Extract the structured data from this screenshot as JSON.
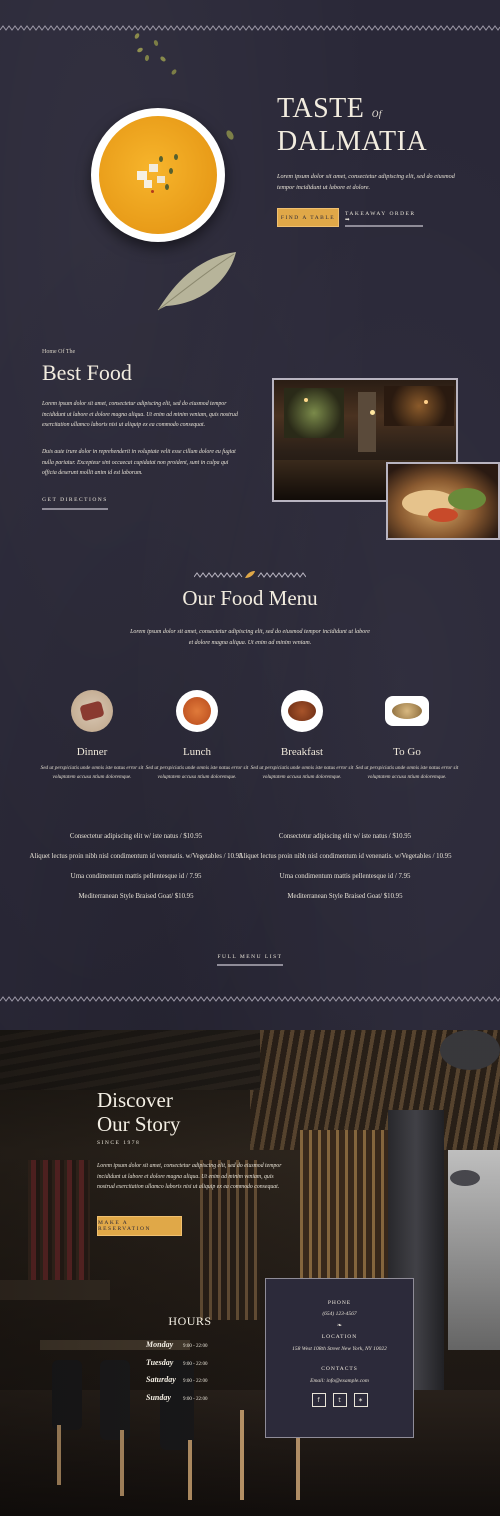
{
  "hero": {
    "title_line1": "TASTE",
    "title_of": "Of",
    "title_line2": "DALMATIA",
    "text": "Lorem ipsum dolor sit amet, consectetur adipiscing elit, sed do eiusmod tempor incididunt ut labore et dolore.",
    "btn_primary": "FIND A TABLE",
    "btn_secondary": "TAKEAWAY ORDER ➡"
  },
  "best_food": {
    "eyebrow": "Home Of The",
    "title": "Best Food",
    "para1": "Lorem ipsum dolor sit amet, consectetur adipiscing elit, sed do eiusmod tempor incididunt ut labore et dolore magna aliqua. Ut enim ad minim veniam, quis nostrud exercitation ullamco laboris nisi ut aliquip ex ea commodo consequat.",
    "para2": "Duis aute irure dolor in reprehenderit in voluptate velit esse cillum dolore eu fugiat nulla pariatur. Excepteur sint occaecat cupidatat non proident, sunt in culpa qui officia deserunt mollit anim id est laborum.",
    "btn": "GET DIRECTIONS"
  },
  "menu": {
    "title": "Our Food Menu",
    "intro": "Lorem ipsum dolor sit amet, consectetur adipiscing elit, sed do eiusmod tempor incididunt ut labore et dolore magna aliqua. Ut enim ad minim veniam.",
    "categories": [
      {
        "name": "Dinner",
        "desc": "Sed ut perspiciatis unde omnis iste natus error sit voluptatem accusa ntium doloremque."
      },
      {
        "name": "Lunch",
        "desc": "Sed ut perspiciatis unde omnis iste natus error sit voluptatem accusa ntium doloremque."
      },
      {
        "name": "Breakfast",
        "desc": "Sed ut perspiciatis unde omnis iste natus error sit voluptatem accusa ntium doloremque."
      },
      {
        "name": "To Go",
        "desc": "Sed ut perspiciatis unde omnis iste natus error sit voluptatem accusa ntium doloremque."
      }
    ],
    "items_left": [
      "Consectetur adipiscing elit w/ iste natus / $10.95",
      "Aliquet lectus proin nibh nisl condimentum id venenatis. w/Vegetables / 10.95",
      "Urna condimentum mattis pellentesque id / 7.95",
      "Mediterranean Style Braised Goat/ $10.95"
    ],
    "items_right": [
      "Consectetur adipiscing elit w/ iste natus / $10.95",
      "Aliquet lectus proin nibh nisl condimentum id venenatis. w/Vegetables / 10.95",
      "Urna condimentum mattis pellentesque id / 7.95",
      "Mediterranean Style Braised Goat/ $10.95"
    ],
    "btn": "FULL MENU LIST"
  },
  "story": {
    "title_line1": "Discover",
    "title_line2": "Our Story",
    "since": "SINCE 1978",
    "text": "Lorem ipsum dolor sit amet, consectetur adipiscing elit, sed do eiusmod tempor incididunt ut labore et dolore magna aliqua. Ut enim ad minim veniam, quis nostrud exercitation ullamco laboris nisi ut aliquip ex ea commodo consequat.",
    "btn": "MAKE A RESERVATION"
  },
  "hours": {
    "title": "HOURS",
    "rows": [
      {
        "day": "Monday",
        "time": "9:00 - 22:00"
      },
      {
        "day": "Tuesday",
        "time": "9:00 - 22:00"
      },
      {
        "day": "Saturday",
        "time": "9:00 - 22:00"
      },
      {
        "day": "Sunday",
        "time": "9:00 - 22:00"
      }
    ]
  },
  "contact": {
    "phone_label": "PHONE",
    "phone": "(654) 123-4567",
    "location_label": "LOCATION",
    "location": "158 West 108th Street New York, NY 10022",
    "contacts_label": "CONTACTS",
    "email": "Email: info@example.com",
    "social": [
      "facebook-icon",
      "twitter-icon",
      "yelp-icon"
    ]
  },
  "colors": {
    "background": "#2a2838",
    "accent_gold": "#e0a848",
    "text": "#e9e4d8"
  }
}
